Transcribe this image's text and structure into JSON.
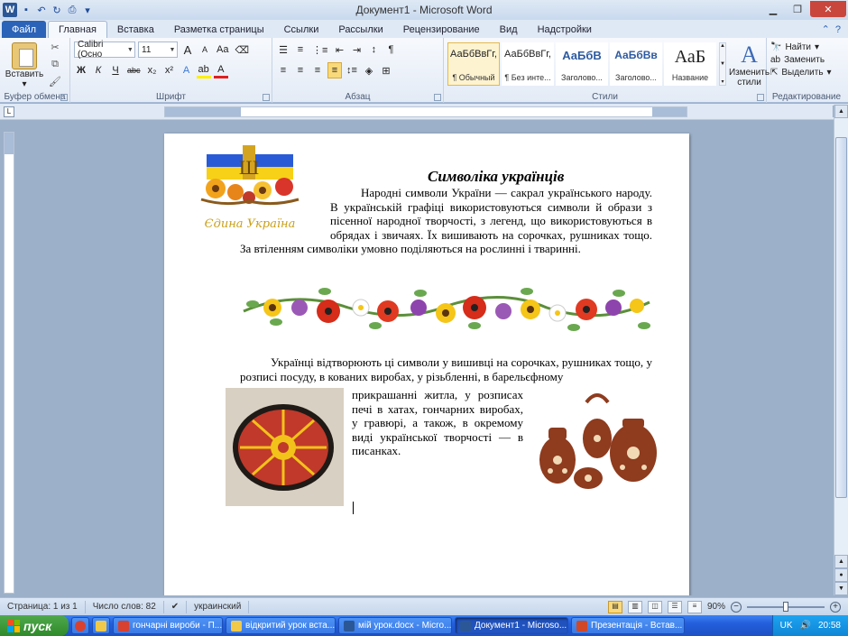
{
  "window": {
    "title": "Документ1 - Microsoft Word",
    "logo": "W"
  },
  "tabs": [
    "Файл",
    "Главная",
    "Вставка",
    "Разметка страницы",
    "Ссылки",
    "Рассылки",
    "Рецензирование",
    "Вид",
    "Надстройки"
  ],
  "ribbon": {
    "clipboard": {
      "paste": "Вставить",
      "label": "Буфер обмена"
    },
    "font": {
      "name": "Calibri (Осно",
      "size": "11",
      "label": "Шрифт",
      "bold": "Ж",
      "italic": "К",
      "underline": "Ч",
      "strike": "abc",
      "sub": "x₂",
      "sup": "x²",
      "grow": "A",
      "shrink": "A",
      "case": "Aa"
    },
    "paragraph": {
      "label": "Абзац"
    },
    "styles": {
      "label": "Стили",
      "items": [
        {
          "sample": "АаБбВвГг,",
          "name": "¶ Обычный"
        },
        {
          "sample": "АаБбВвГг,",
          "name": "¶ Без инте..."
        },
        {
          "sample": "АаБбВ",
          "name": "Заголово..."
        },
        {
          "sample": "АаБбВв",
          "name": "Заголово..."
        },
        {
          "sample": "АаБ",
          "name": "Название"
        }
      ],
      "change": "Изменить стили"
    },
    "editing": {
      "label": "Редактирование",
      "find": "Найти",
      "replace": "Заменить",
      "select": "Выделить"
    }
  },
  "document": {
    "title": "Символіка українців",
    "logo_caption": "Єдина Україна",
    "para1": "Народні символи України — сакрал українського народу. В українській графіці використовуються символи й образи з пісенної народної творчості, з легенд, що використовуються в обрядах і звичаях. Їх вишивають на сорочках, рушниках тощо. За втіленням символіки умовно поділяються на рослинні і тваринні.",
    "para2": "Українці відтворюють ці символи у вишивці на сорочках, рушниках тощо, у розписі посуду, в кованих виробах, у різьбленні, в барельєфному",
    "para3": "прикрашанні житла, у розписах печі в хатах, гончарних виробах, у гравюрі, а також, в окремому виді української творчості — в писанках."
  },
  "status": {
    "page": "Страница: 1 из 1",
    "words": "Число слов: 82",
    "lang": "украинский",
    "zoom": "90%"
  },
  "taskbar": {
    "start": "пуск",
    "items": [
      {
        "label": "гончарні вироби - П...",
        "color": "#d8412f"
      },
      {
        "label": "відкритий урок вста...",
        "color": "#f0c94a"
      },
      {
        "label": "мій урок.docx - Micro...",
        "color": "#2b5797"
      },
      {
        "label": "Документ1 - Microso...",
        "color": "#2b5797"
      },
      {
        "label": "Презентація - Встав...",
        "color": "#d24726"
      }
    ],
    "lang": "UK",
    "clock": "20:58"
  }
}
